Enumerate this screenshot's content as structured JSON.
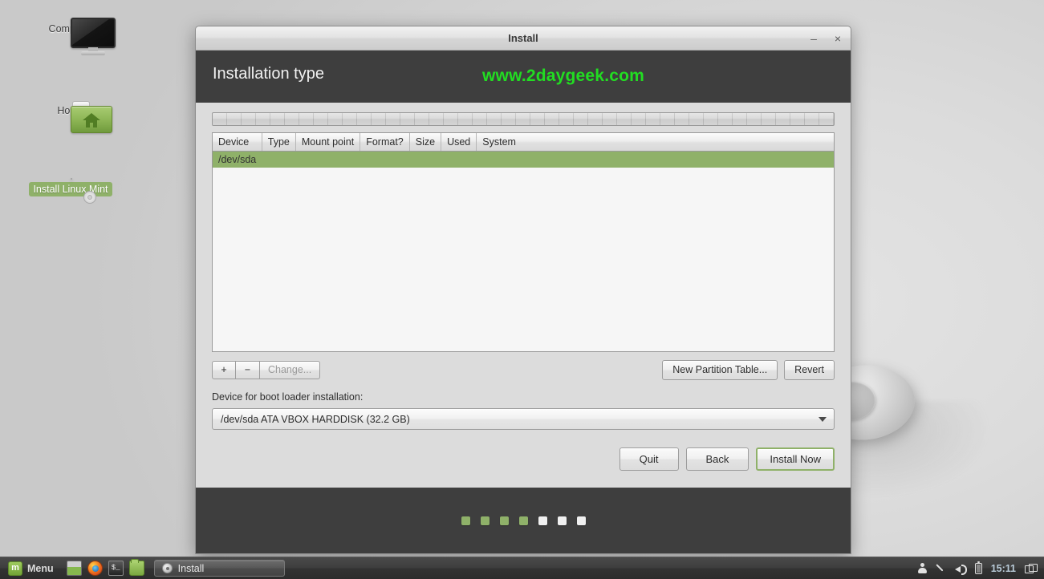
{
  "desktop": {
    "icons": [
      {
        "label": "Computer",
        "icon": "monitor-icon",
        "selected": false
      },
      {
        "label": "Home",
        "icon": "home-folder-icon",
        "selected": false
      },
      {
        "label": "Install Linux Mint",
        "icon": "cd-disc-icon",
        "selected": true
      }
    ],
    "background_color": "#d8d8d8"
  },
  "window": {
    "title": "Install",
    "minimize_label": "–",
    "close_label": "×",
    "banner": {
      "page_title": "Installation type",
      "watermark": "www.2daygeek.com",
      "watermark_color": "#22dd22",
      "background_color": "#3e3e3e"
    },
    "partition_bar": {
      "segments": 46
    },
    "table": {
      "columns": [
        "Device",
        "Type",
        "Mount point",
        "Format?",
        "Size",
        "Used",
        "System"
      ],
      "rows": [
        {
          "selected": true,
          "device": "/dev/sda",
          "type": "",
          "mount_point": "",
          "format": "",
          "size": "",
          "used": "",
          "system": ""
        }
      ],
      "selection_color": "#8fb169"
    },
    "toolbar": {
      "add_label": "+",
      "remove_label": "−",
      "change_label": "Change...",
      "change_disabled": true,
      "new_partition_table_label": "New Partition Table...",
      "revert_label": "Revert"
    },
    "boot_loader": {
      "label": "Device for boot loader installation:",
      "selected_value": "/dev/sda  ATA VBOX HARDDISK (32.2 GB)"
    },
    "actions": {
      "quit_label": "Quit",
      "back_label": "Back",
      "install_now_label": "Install Now",
      "primary_focus_color": "#8fb169"
    },
    "progress_dots": {
      "total": 7,
      "completed": 4,
      "done_color": "#8fb169",
      "pending_color": "#f0f0f0"
    }
  },
  "taskbar": {
    "menu_label": "Menu",
    "menu_logo": "m",
    "launchers": [
      {
        "name": "show-desktop-icon"
      },
      {
        "name": "firefox-icon"
      },
      {
        "name": "terminal-icon",
        "glyph": "$_"
      },
      {
        "name": "files-icon"
      }
    ],
    "window_buttons": [
      {
        "label": "Install",
        "icon": "disc-icon",
        "active": true
      }
    ],
    "tray": {
      "user_icon": "user-icon",
      "pen_icon": "pen-icon",
      "volume_icon": "volume-icon",
      "battery_icon": "battery-icon",
      "clock": "15:11",
      "workspace_icon": "workspace-switcher-icon"
    }
  }
}
